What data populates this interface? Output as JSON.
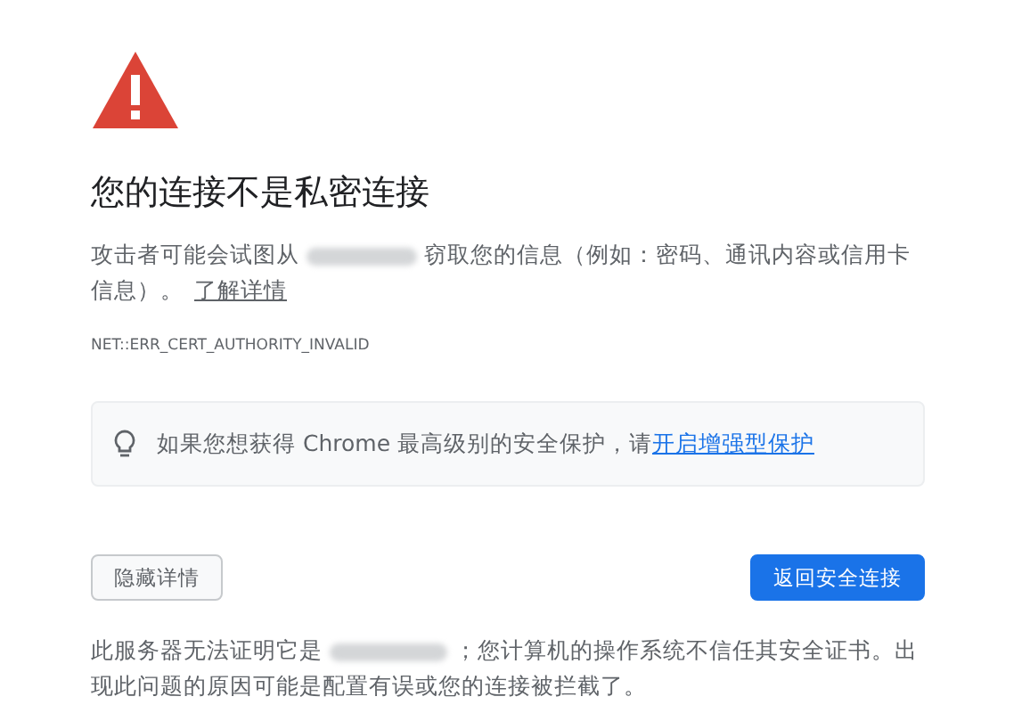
{
  "title": "您的连接不是私密连接",
  "description": {
    "before": "攻击者可能会试图从",
    "after": "窃取您的信息（例如：密码、通讯内容或信用卡信息）。",
    "link": "了解详情"
  },
  "error_code": "NET::ERR_CERT_AUTHORITY_INVALID",
  "tip": {
    "text": "如果您想获得 Chrome 最高级别的安全保护，请",
    "link": "开启增强型保护"
  },
  "buttons": {
    "details": "隐藏详情",
    "back": "返回安全连接"
  },
  "details": {
    "before": "此服务器无法证明它是",
    "after": "；您计算机的操作系统不信任其安全证书。出现此问题的原因可能是配置有误或您的连接被拦截了。"
  }
}
